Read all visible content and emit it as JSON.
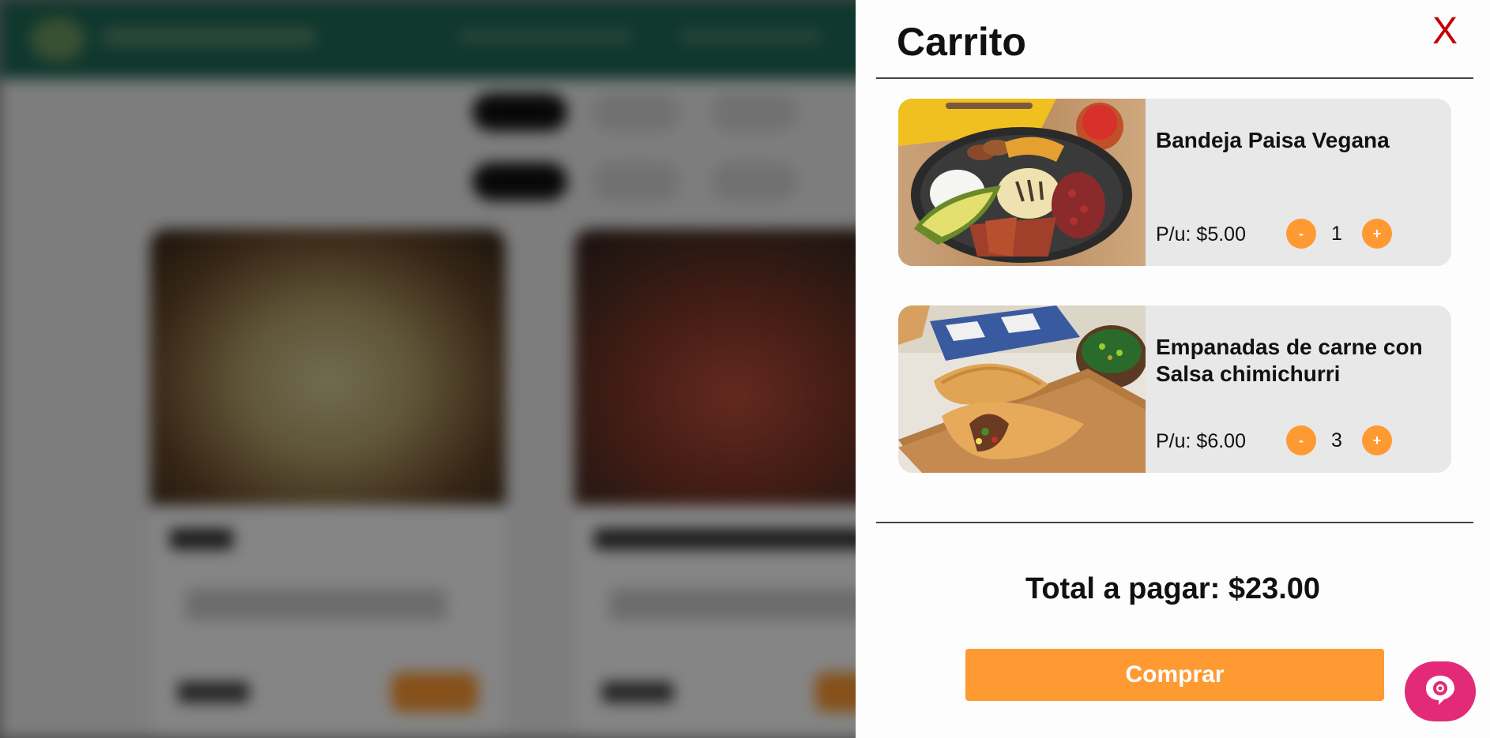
{
  "cart": {
    "title": "Carrito",
    "close_label": "X",
    "items": [
      {
        "name": "Bandeja Paisa Vegana",
        "price": "P/u: $5.00",
        "quantity": "1",
        "minus": "-",
        "plus": "+"
      },
      {
        "name": "Empanadas de carne con Salsa chimichurri",
        "price": "P/u: $6.00",
        "quantity": "3",
        "minus": "-",
        "plus": "+"
      }
    ],
    "total": "Total a pagar: $23.00",
    "buy_label": "Comprar"
  },
  "icons": {
    "chat": "chat-bubble-icon"
  },
  "colors": {
    "accent": "#ff9a33",
    "close": "#c40000",
    "chat": "#e22a78",
    "header": "#1f6a57"
  }
}
